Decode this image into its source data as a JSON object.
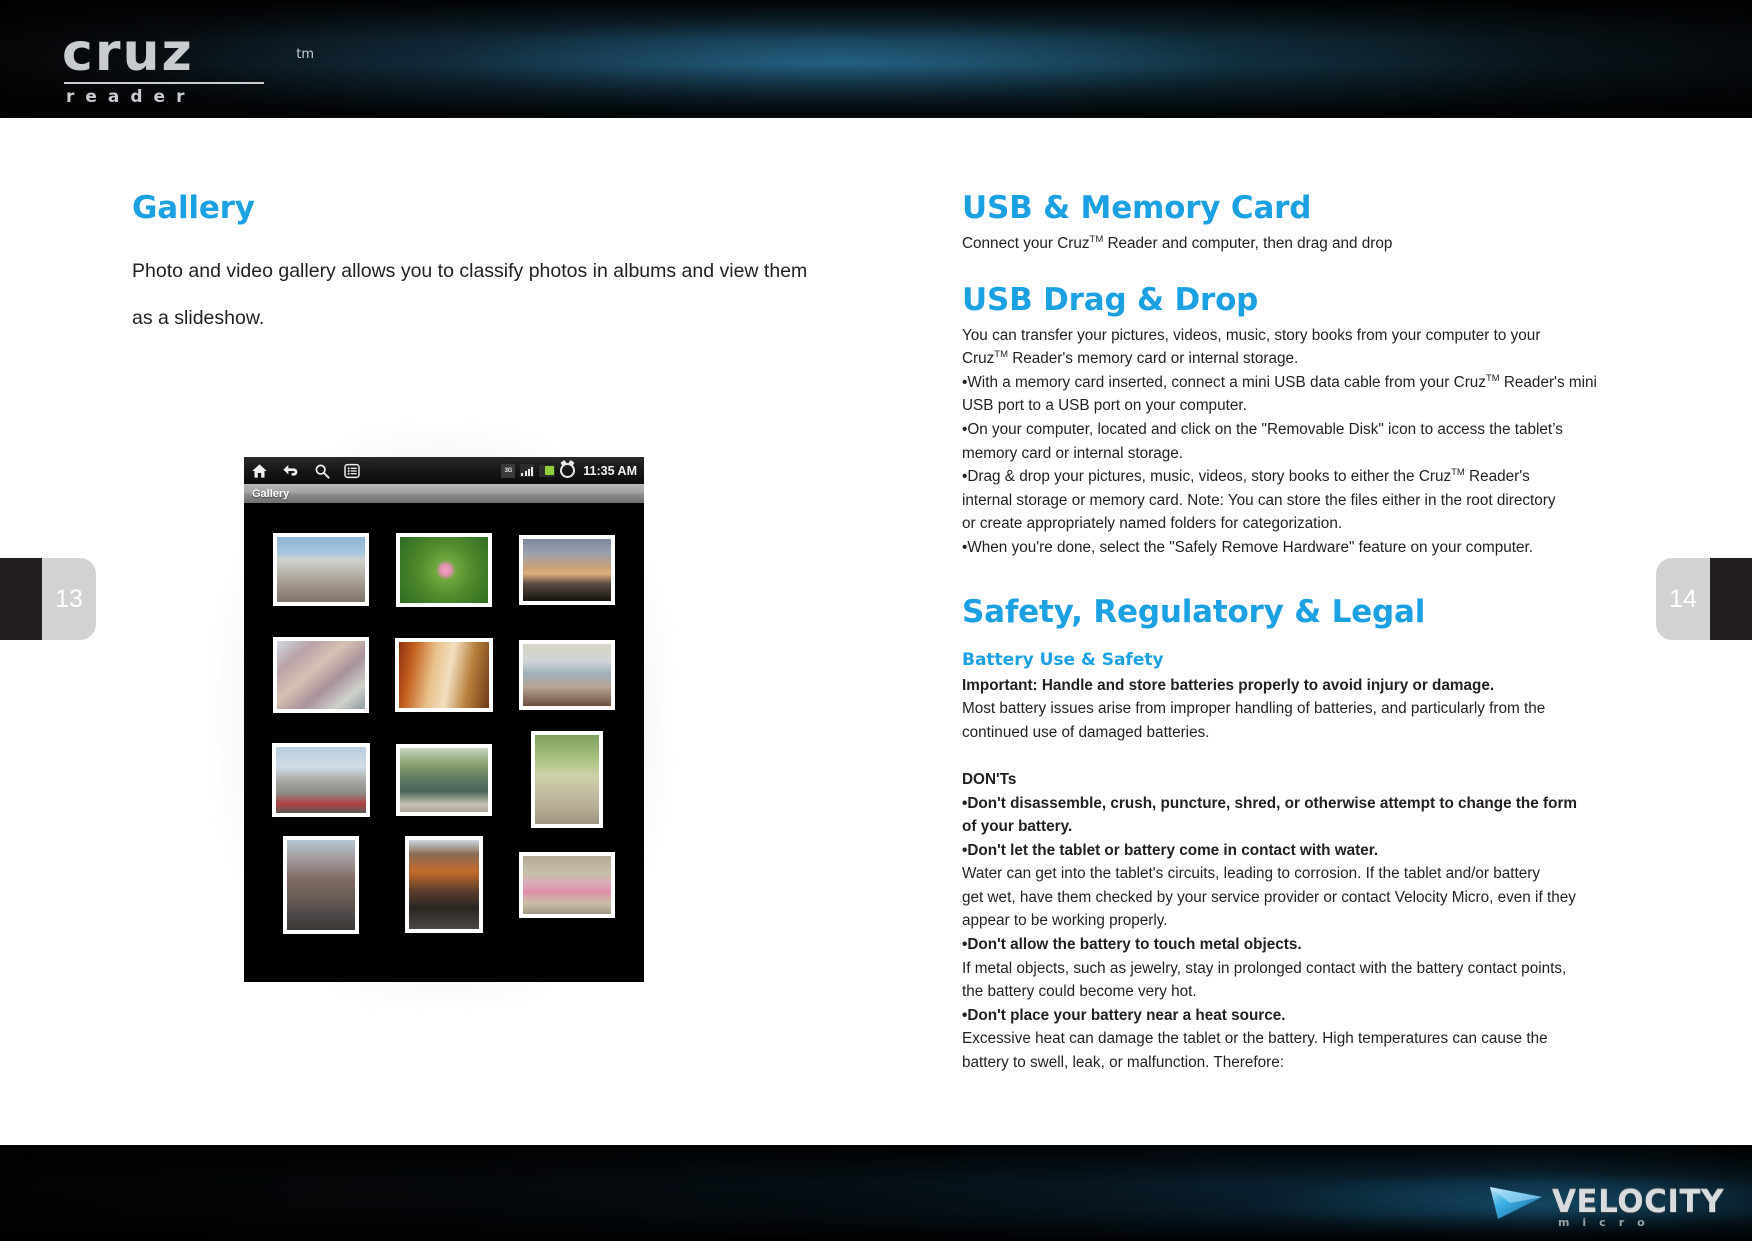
{
  "brand": {
    "logo_word": "cruz",
    "logo_tm": "TM",
    "logo_sub": "reader",
    "footer_main": "VELOCITY",
    "footer_sub": "micro"
  },
  "pages": {
    "left": "13",
    "right": "14"
  },
  "left_column": {
    "title": "Gallery",
    "lead": "Photo and video gallery allows you to classify photos in albums and view them as a slideshow."
  },
  "tablet": {
    "status_bar": {
      "icons": [
        "home-icon",
        "back-icon",
        "search-icon",
        "menu-icon"
      ],
      "network": "3G",
      "signal": "signal-bars-icon",
      "storage": "sd-card-icon",
      "alarm": "alarm-clock-icon",
      "clock": "11:35 AM"
    },
    "title_bar": "Gallery",
    "thumbnails": [
      {
        "name": "rooftop-view",
        "class": "pic-rooftop"
      },
      {
        "name": "lotus-flower",
        "class": "pic-lotus"
      },
      {
        "name": "sunset-skyline",
        "class": "pic-sunset"
      },
      {
        "name": "temple-facade",
        "class": "pic-temple"
      },
      {
        "name": "room-interior",
        "class": "pic-interior"
      },
      {
        "name": "window-balcony",
        "class": "pic-window"
      },
      {
        "name": "street-decorations",
        "class": "pic-street1"
      },
      {
        "name": "bronze-statue",
        "class": "pic-statue"
      },
      {
        "name": "tree-lined-alley",
        "class": "pic-alley"
      },
      {
        "name": "city-street",
        "class": "pic-street2"
      },
      {
        "name": "cinema-corner",
        "class": "pic-cinema"
      },
      {
        "name": "cafe-terrace",
        "class": "pic-cafe"
      }
    ]
  },
  "right_column": {
    "usb_memory": {
      "title": "USB & Memory Card",
      "line_pre": "Connect your Cruz",
      "line_tm": "TM",
      "line_post": " Reader and computer, then drag and drop"
    },
    "usb_drag_drop": {
      "title": "USB Drag & Drop",
      "intro_1": "You can transfer your pictures, videos, music, story books from your computer to your",
      "intro_2_pre": "Cruz",
      "intro_2_tm": "TM",
      "intro_2_post": " Reader's memory card or internal storage.",
      "b1_pre": "•With a memory card inserted, connect a mini USB data cable from your Cruz",
      "b1_tm": "TM",
      "b1_post": " Reader's mini",
      "b1_line2": "USB port to a USB port on your computer.",
      "b2_line1": "•On your computer, located and click on the \"Removable Disk\" icon to access the tablet’s",
      "b2_line2": "memory card or internal storage.",
      "b3_pre": "•Drag & drop your pictures, music, videos, story books to either the Cruz",
      "b3_tm": "TM",
      "b3_post": " Reader's",
      "b3_line2": "internal storage or memory card. Note: You can store the files either in the root directory",
      "b3_line3": "or create appropriately named folders for categorization.",
      "b4": "•When you're done, select the \"Safely Remove Hardware\" feature on your computer."
    },
    "safety": {
      "title": "Safety, Regulatory & Legal",
      "subtitle": "Battery Use & Safety",
      "important": "Important: Handle and store batteries properly to avoid injury or damage.",
      "p1_line1": "Most battery issues arise from improper handling of batteries, and particularly from the",
      "p1_line2": "continued use of damaged batteries.",
      "donts_heading": "DON'Ts",
      "d1_line1": "•Don't disassemble, crush, puncture, shred, or otherwise attempt to change the form",
      "d1_line2": "of your battery.",
      "d2": "•Don't let the tablet or battery come in contact with water.",
      "d2_body_1": "Water can get into the tablet's circuits, leading to corrosion. If the tablet and/or battery",
      "d2_body_2": "get wet, have them checked by your service provider or contact Velocity Micro, even if they",
      "d2_body_3": "appear to be working properly.",
      "d3": "•Don't allow the battery to touch metal objects.",
      "d3_body_1": "If metal objects, such as jewelry, stay in prolonged contact with the battery contact points,",
      "d3_body_2": "the battery could become very hot.",
      "d4": "•Don't place your battery near a heat source.",
      "d4_body_1": "Excessive heat can damage the tablet or the battery. High temperatures can cause the",
      "d4_body_2": "battery to swell, leak, or malfunction. Therefore:"
    }
  },
  "colors": {
    "accent": "#1ba1e2",
    "body": "#231f20",
    "tab_light": "#d0d2d4",
    "tab_dark": "#231f20"
  }
}
